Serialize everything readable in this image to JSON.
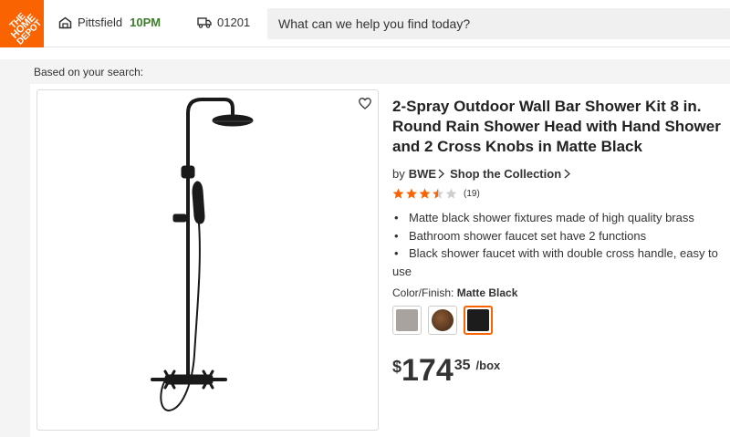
{
  "header": {
    "logo": {
      "lines": [
        "THE",
        "HOME",
        "DEPOT"
      ],
      "bg": "#f96302"
    },
    "store": {
      "name": "Pittsfield",
      "hours": "10PM",
      "icon": "store-icon"
    },
    "zip": {
      "value": "01201",
      "icon": "truck-icon"
    },
    "search": {
      "placeholder": "What can we help you find today?"
    }
  },
  "context": {
    "based_on": "Based on your search:"
  },
  "product": {
    "title": "2-Spray Outdoor Wall Bar Shower Kit 8 in. Round Rain Shower Head with Hand Shower and 2 Cross Knobs in Matte Black",
    "brand_prefix": "by",
    "brand": "BWE",
    "collection": "Shop the Collection",
    "rating": {
      "value": 3.5,
      "max": 5,
      "count": "(19)"
    },
    "bullets": [
      "Matte black shower fixtures made of high quality brass",
      "Bathroom shower faucet set have 2 functions",
      "Black shower faucet with with double cross handle, easy to use"
    ],
    "finish": {
      "label": "Color/Finish:",
      "selected": "Matte Black",
      "options": [
        {
          "name": "Brushed Nickel",
          "color": "#a8a39e"
        },
        {
          "name": "Oil Rubbed Bronze",
          "color": "#5a3a22"
        },
        {
          "name": "Matte Black",
          "color": "#1c1c1c"
        }
      ],
      "selected_index": 2
    },
    "price": {
      "currency": "$",
      "dollars": "174",
      "cents": "35",
      "unit": "/box"
    }
  },
  "colors": {
    "accent": "#f96302",
    "hours_green": "#3e7d2b",
    "star": "#f96302"
  }
}
